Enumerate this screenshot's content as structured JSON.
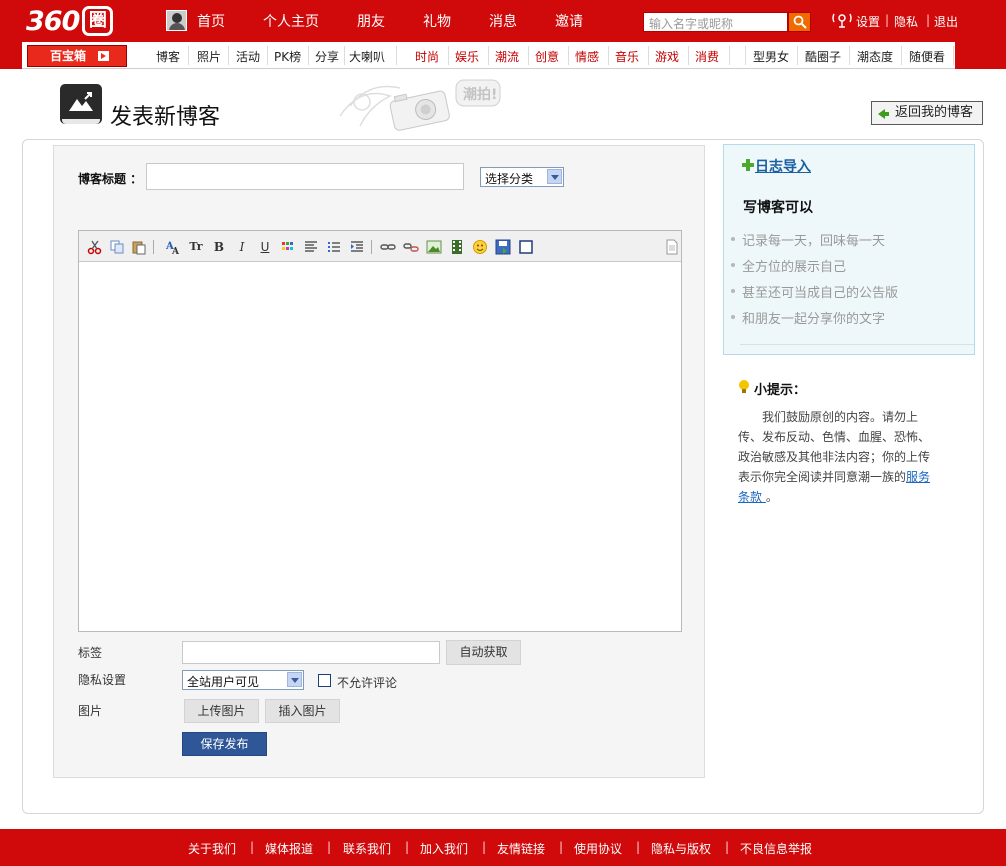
{
  "header": {
    "logo_number": "360",
    "logo_char": "圈",
    "nav": [
      "首页",
      "个人主页",
      "朋友",
      "礼物",
      "消息",
      "邀请"
    ],
    "search_placeholder": "输入名字或昵称",
    "user_links": [
      "设置",
      "隐私",
      "退出"
    ]
  },
  "subnav": {
    "toolbox": "百宝箱",
    "dark_items": [
      "博客",
      "照片",
      "活动",
      "PK榜",
      "分享",
      "大喇叭"
    ],
    "red_items": [
      "时尚",
      "娱乐",
      "潮流",
      "创意",
      "情感",
      "音乐",
      "游戏",
      "消费"
    ],
    "right_items": [
      "型男女",
      "酷圈子",
      "潮态度",
      "随便看"
    ]
  },
  "page": {
    "title": "发表新博客",
    "deco_text": "潮拍!",
    "back_button": "返回我的博客"
  },
  "form": {
    "title_label": "博客标题 ：",
    "title_value": "",
    "category_selected": "选择分类",
    "tags_label": "标签",
    "tags_value": "",
    "auto_fetch": "自动获取",
    "privacy_label": "隐私设置",
    "privacy_selected": "全站用户可见",
    "no_comment_label": "不允许评论",
    "no_comment_checked": false,
    "image_label": "图片",
    "upload_image": "上传图片",
    "insert_image": "插入图片",
    "publish": "保存发布"
  },
  "editor": {
    "content": "",
    "toolbar": [
      "cut-icon",
      "copy-icon",
      "paste-icon",
      "font-icon",
      "font-size-icon",
      "bold-icon",
      "italic-icon",
      "underline-icon",
      "color-icon",
      "align-icon",
      "list-icon",
      "indent-icon",
      "link-icon",
      "unlink-icon",
      "image-icon",
      "video-icon",
      "emoticon-icon",
      "save-icon",
      "box-icon",
      "source-icon"
    ],
    "bold_glyph": "B",
    "italic_glyph": "I",
    "underline_glyph": "U",
    "fontsize_glyph": "Tr"
  },
  "sidebar": {
    "import_link": "日志导入",
    "heading": "写博客可以",
    "items": [
      "记录每一天，回味每一天",
      "全方位的展示自己",
      "甚至还可当成自己的公告版",
      "和朋友一起分享你的文字"
    ],
    "tip_title": "小提示：",
    "tip_lines": [
      "我们鼓励原创的内容。请勿上",
      "传、发布反动、色情、血腥、恐怖、",
      "政治敏感及其他非法内容；你的上传",
      "表示你完全阅读并同意潮一族的"
    ],
    "tip_link_1": "服务",
    "tip_link_2": "条款 ",
    "tip_end": "。"
  },
  "footer": {
    "links": [
      "关于我们",
      "媒体报道",
      "联系我们",
      "加入我们",
      "友情链接",
      "使用协议",
      "隐私与版权",
      "不良信息举报"
    ],
    "separator": "|"
  },
  "colors": {
    "brand_red": "#d00a0a",
    "publish_blue": "#2f5797",
    "side_box_bg": "#eef8fb"
  }
}
